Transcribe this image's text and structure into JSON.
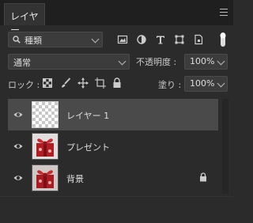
{
  "panel": {
    "tab_label": "レイヤー"
  },
  "filter": {
    "label": "種類"
  },
  "blend": {
    "mode": "通常",
    "opacity_label": "不透明度 :",
    "opacity_value": "100%"
  },
  "lock": {
    "label": "ロック :",
    "fill_label": "塗り :",
    "fill_value": "100%"
  },
  "layers": [
    {
      "name": "レイヤー 1",
      "selected": true,
      "thumb": "transparent",
      "locked": false
    },
    {
      "name": "プレゼント",
      "selected": false,
      "thumb": "gift",
      "locked": false
    },
    {
      "name": "背景",
      "selected": false,
      "thumb": "gift",
      "locked": true
    }
  ],
  "colors": {
    "panel_bg": "#2b2b2b",
    "selected_row": "#4a4a4a",
    "gift_red": "#b01e24"
  }
}
